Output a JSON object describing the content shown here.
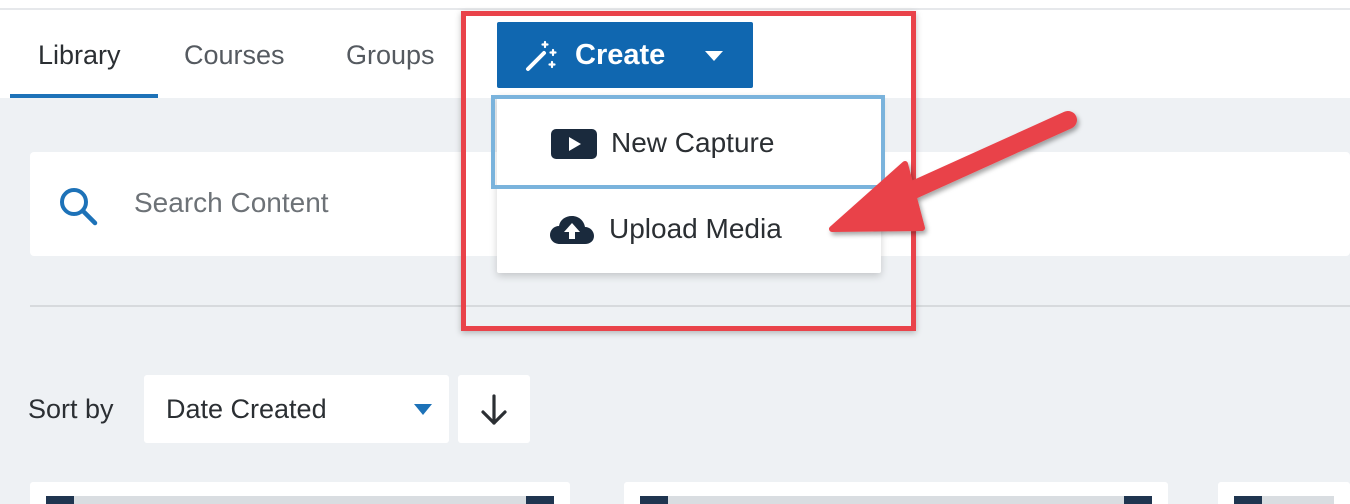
{
  "tabs": [
    {
      "label": "Library",
      "active": true
    },
    {
      "label": "Courses",
      "active": false
    },
    {
      "label": "Groups",
      "active": false
    }
  ],
  "create_button": {
    "label": "Create",
    "icon": "magic-wand-icon",
    "color": "#1067b0"
  },
  "create_menu": {
    "items": [
      {
        "label": "New Capture",
        "icon": "video-play-icon"
      },
      {
        "label": "Upload Media",
        "icon": "cloud-upload-icon"
      }
    ]
  },
  "search": {
    "placeholder": "Search Content",
    "value": "",
    "icon": "search-icon"
  },
  "sort": {
    "label": "Sort by",
    "selected": "Date Created",
    "direction_icon": "arrow-down-icon"
  },
  "annotation": {
    "highlight_color": "#e9434a",
    "arrow_color": "#e9434a"
  },
  "colors": {
    "accent": "#1d72b8",
    "background": "#eef1f4"
  }
}
